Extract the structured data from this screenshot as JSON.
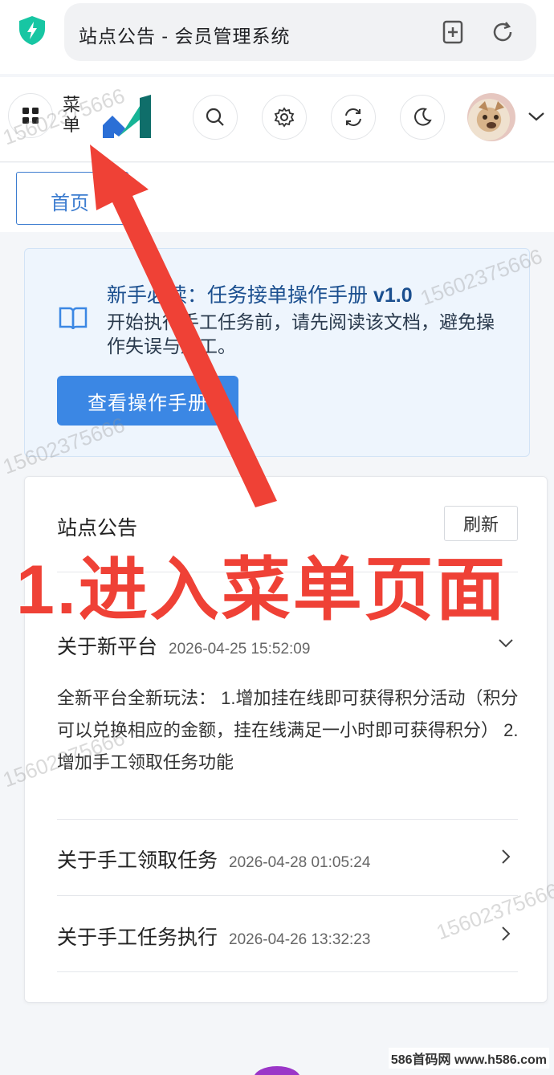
{
  "browser": {
    "page_title": "站点公告 - 会员管理系统",
    "shield_color": "#17c6a3"
  },
  "header": {
    "menu_label": "菜单",
    "icons": [
      "grid-icon",
      "search-icon",
      "gear-icon",
      "sync-icon",
      "moon-icon",
      "chevron-down-icon"
    ]
  },
  "tabs": {
    "home_label": "首页"
  },
  "guide": {
    "title": "新手必读：任务接单操作手册 ",
    "version": "v1.0",
    "description": "开始执行手工任务前，请先阅读该文档，避免操作失误与返工。",
    "button_label": "查看操作手册"
  },
  "notice": {
    "title": "站点公告",
    "refresh_label": "刷新",
    "items": [
      {
        "title": "关于新平台",
        "time": "2026-04-25 15:52:09",
        "body": "全新平台全新玩法： 1.增加挂在线即可获得积分活动（积分可以兑换相应的金额，挂在线满足一小时即可获得积分） 2.增加手工领取任务功能"
      },
      {
        "title": "关于手工领取任务",
        "time": "2026-04-28 01:05:24"
      },
      {
        "title": "关于手工任务执行",
        "time": "2026-04-26 13:32:23"
      }
    ]
  },
  "overlay": {
    "caption": "1.进入菜单页面",
    "color": "#ef4136"
  },
  "watermark": {
    "text": "15602375666"
  },
  "credit": "586首码网 www.h586.com"
}
